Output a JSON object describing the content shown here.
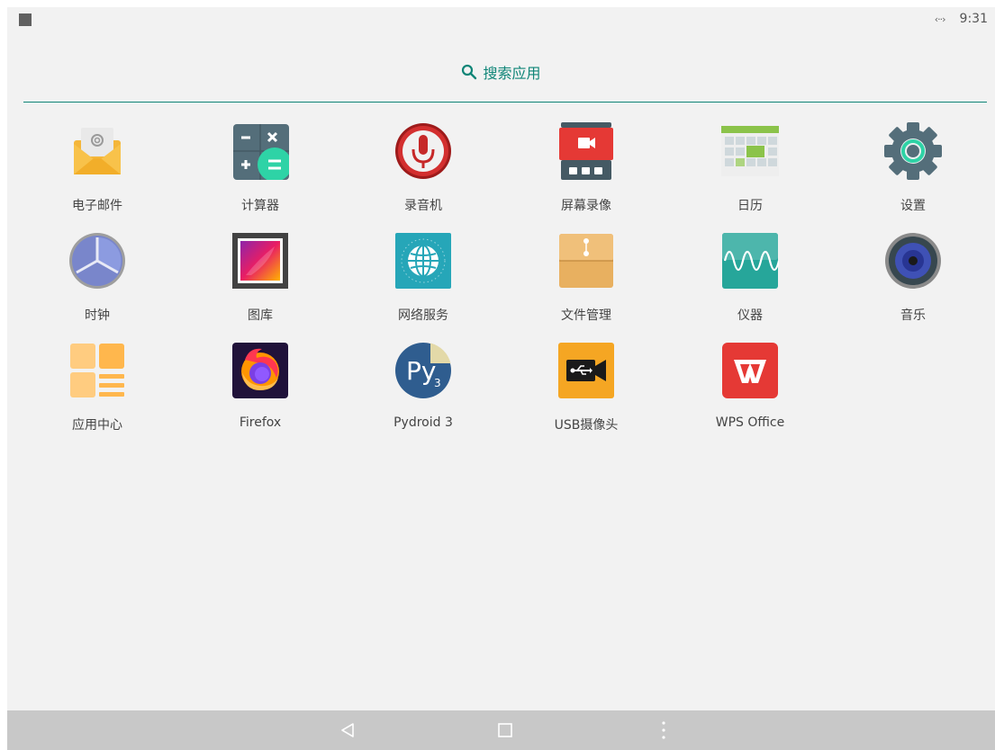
{
  "status_bar": {
    "time": "9:31",
    "data_icon": "‹··›",
    "left_icon": "square-notification-icon"
  },
  "search": {
    "label": "搜索应用",
    "icon": "search-icon"
  },
  "apps": [
    {
      "label": "电子邮件",
      "icon": "email-icon"
    },
    {
      "label": "计算器",
      "icon": "calculator-icon"
    },
    {
      "label": "录音机",
      "icon": "microphone-icon"
    },
    {
      "label": "屏幕录像",
      "icon": "screen-recorder-icon"
    },
    {
      "label": "日历",
      "icon": "calendar-icon"
    },
    {
      "label": "设置",
      "icon": "gear-icon"
    },
    {
      "label": "时钟",
      "icon": "clock-icon"
    },
    {
      "label": "图库",
      "icon": "gallery-icon"
    },
    {
      "label": "网络服务",
      "icon": "globe-icon"
    },
    {
      "label": "文件管理",
      "icon": "folder-icon"
    },
    {
      "label": "仪器",
      "icon": "waveform-icon"
    },
    {
      "label": "音乐",
      "icon": "speaker-icon"
    },
    {
      "label": "应用中心",
      "icon": "app-center-icon"
    },
    {
      "label": "Firefox",
      "icon": "firefox-icon"
    },
    {
      "label": "Pydroid 3",
      "icon": "pydroid-icon"
    },
    {
      "label": "USB摄像头",
      "icon": "usb-camera-icon"
    },
    {
      "label": "WPS Office",
      "icon": "wps-office-icon"
    }
  ],
  "nav_bar": {
    "back": "back-icon",
    "home": "home-icon",
    "menu": "more-icon"
  },
  "colors": {
    "accent": "#0f8577",
    "background": "#f2f2f2",
    "nav_bar": "#c8c8c8"
  }
}
